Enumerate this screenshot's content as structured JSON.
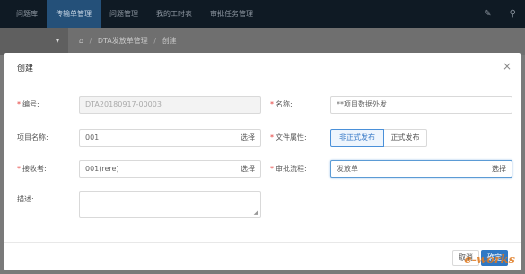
{
  "nav": {
    "items": [
      "问题库",
      "传输单管理",
      "问题管理",
      "我的工时表",
      "审批任务管理"
    ],
    "active_index": 1,
    "right_icons": [
      "pin-icon",
      "user-icon"
    ],
    "right_glyphs": [
      "✎",
      "⚲"
    ]
  },
  "subbar": {
    "toggle": "▾",
    "crumbs": [
      "⌂",
      "DTA发放单管理",
      "创建"
    ]
  },
  "dialog": {
    "title": "创建",
    "close": "×",
    "fields": {
      "code_label": "编号:",
      "code_value": "DTA20180917-00003",
      "name_label": "名称:",
      "name_value": "**项目数据外发",
      "project_label": "项目名称:",
      "project_value": "001",
      "project_pick": "选择",
      "attr_label": "文件属性:",
      "attr_options": [
        "非正式发布",
        "正式发布"
      ],
      "attr_selected": 0,
      "receiver_label": "接收者:",
      "receiver_value": "001(rere)",
      "receiver_pick": "选择",
      "flow_label": "审批流程:",
      "flow_value": "发放单",
      "flow_pick": "选择",
      "desc_label": "描述:",
      "desc_value": ""
    },
    "required_mark": "*",
    "footer": {
      "cancel": "取消",
      "confirm": "确定"
    },
    "watermark": "e-works"
  },
  "colors": {
    "accent": "#2f78c4",
    "required": "#e53935",
    "nav_bg": "#0f1a24"
  }
}
